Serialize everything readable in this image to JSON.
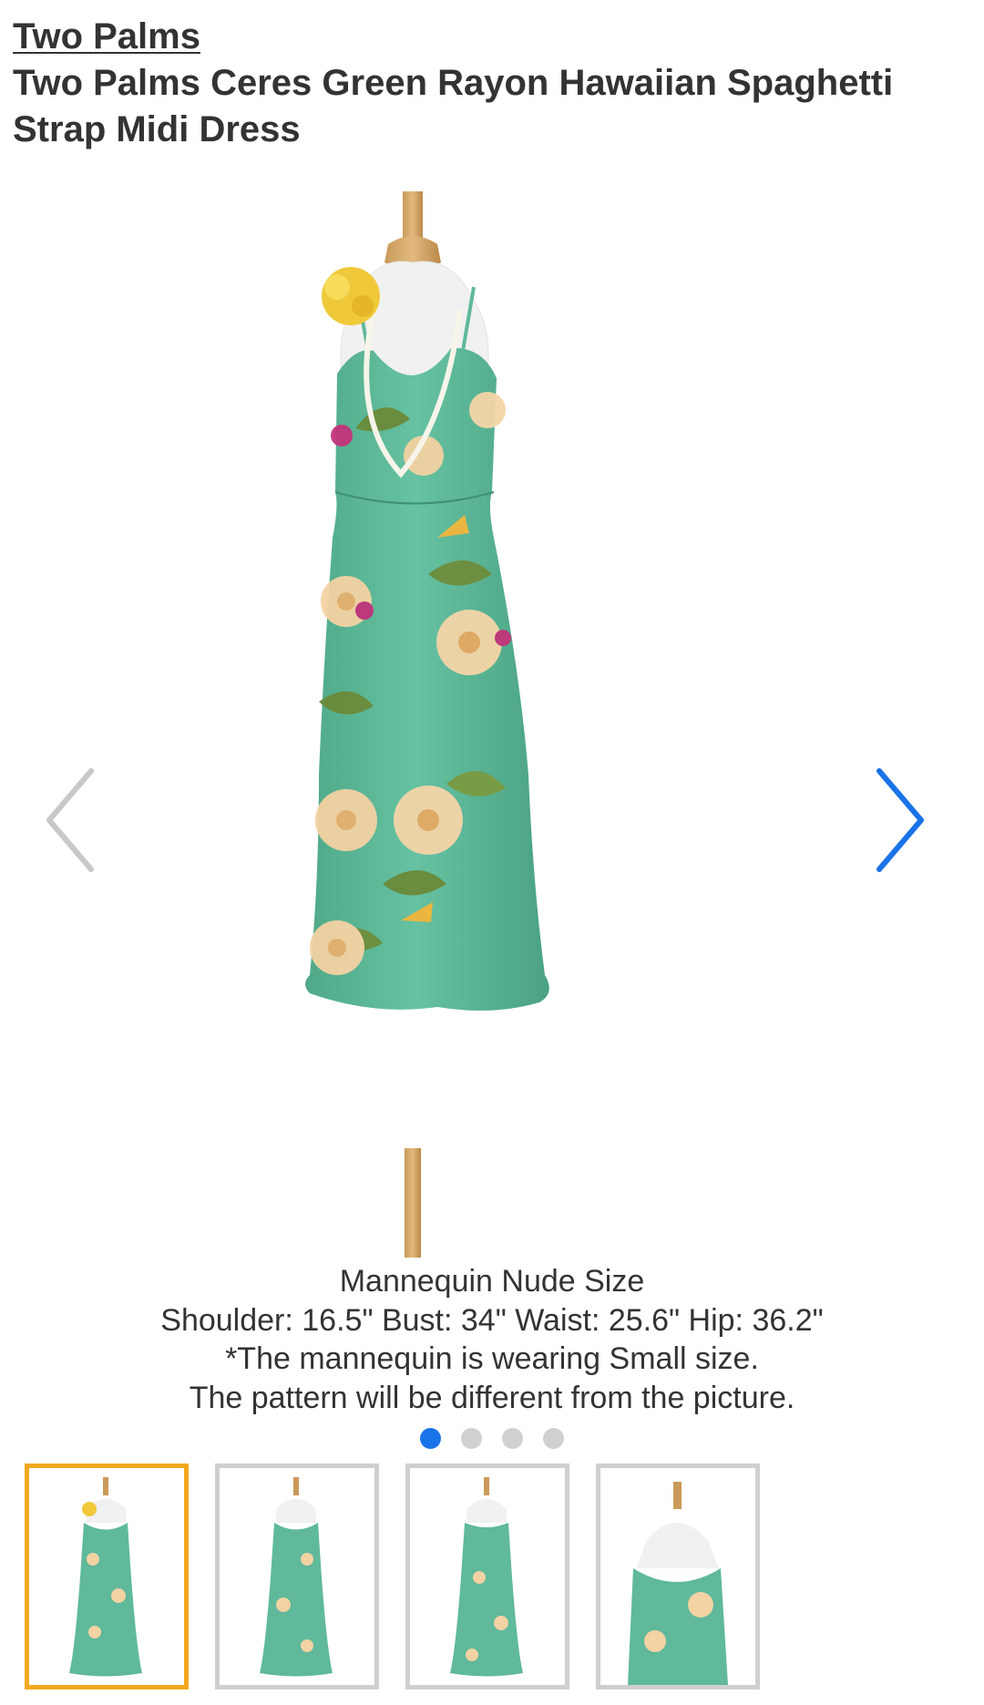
{
  "product": {
    "brand": "Two Palms",
    "title": "Two Palms Ceres Green Rayon Hawaiian Spaghetti Strap Midi Dress"
  },
  "gallery": {
    "image_alt": "green floral spaghetti strap midi dress on mannequin",
    "prev_icon": "chevron-left-icon",
    "next_icon": "chevron-right-icon",
    "caption_lines": [
      "Mannequin Nude Size",
      "Shoulder: 16.5\" Bust: 34\" Waist: 25.6\" Hip: 36.2\"",
      "*The mannequin is wearing Small size.",
      "The pattern will be different from the picture."
    ],
    "slide_count": 4,
    "active_slide": 1,
    "thumbnails": [
      {
        "label": "front view with lei",
        "selected": true
      },
      {
        "label": "front view",
        "selected": false
      },
      {
        "label": "back view",
        "selected": false
      },
      {
        "label": "side close-up view",
        "selected": false
      }
    ]
  },
  "colors": {
    "dress_green": "#5fb99a",
    "accent_blue": "#1a73e8",
    "selected_border": "#f2a81d",
    "inactive_arrow": "#c8c8c8"
  }
}
